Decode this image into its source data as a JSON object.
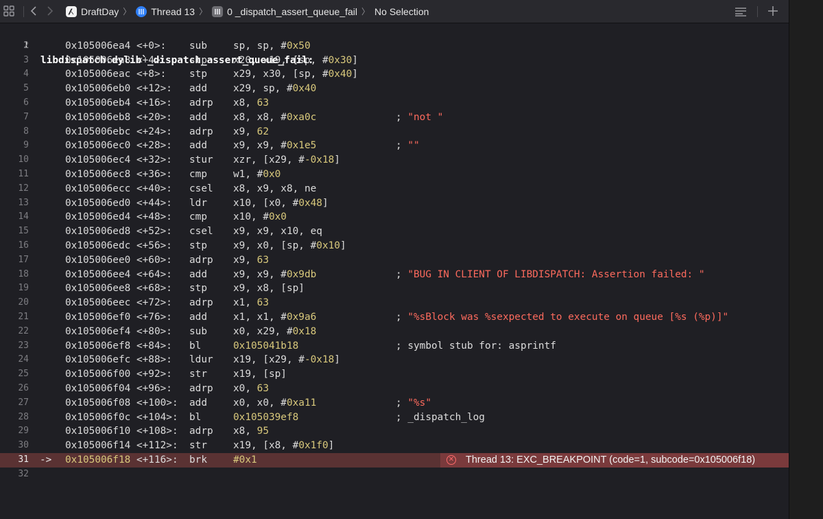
{
  "jumpbar": {
    "crumbs": [
      {
        "label": "DraftDay",
        "icon": "app-icon"
      },
      {
        "label": "Thread 13",
        "icon": "thread-icon"
      },
      {
        "label": "0 _dispatch_assert_queue_fail",
        "icon": "stack-frame-icon"
      },
      {
        "label": "No Selection",
        "icon": ""
      }
    ]
  },
  "disassembly": {
    "header": {
      "num": "1",
      "text": "libdispatch.dylib`_dispatch_assert_queue_fail:"
    },
    "lines": [
      {
        "num": "2",
        "addr": "0x105006ea4",
        "off": "<+0>:",
        "mn": "sub",
        "op": [
          [
            "sp, sp, #",
            ""
          ],
          [
            "0x50",
            "n"
          ]
        ]
      },
      {
        "num": "3",
        "addr": "0x105006ea8",
        "off": "<+4>:",
        "mn": "stp",
        "op": [
          [
            "x20, x19, [sp, #",
            ""
          ],
          [
            "0x30",
            "n"
          ],
          [
            "]",
            ""
          ]
        ]
      },
      {
        "num": "4",
        "addr": "0x105006eac",
        "off": "<+8>:",
        "mn": "stp",
        "op": [
          [
            "x29, x30, [sp, #",
            ""
          ],
          [
            "0x40",
            "n"
          ],
          [
            "]",
            ""
          ]
        ]
      },
      {
        "num": "5",
        "addr": "0x105006eb0",
        "off": "<+12>:",
        "mn": "add",
        "op": [
          [
            "x29, sp, #",
            ""
          ],
          [
            "0x40",
            "n"
          ]
        ]
      },
      {
        "num": "6",
        "addr": "0x105006eb4",
        "off": "<+16>:",
        "mn": "adrp",
        "op": [
          [
            "x8, ",
            ""
          ],
          [
            "63",
            "n"
          ]
        ]
      },
      {
        "num": "7",
        "addr": "0x105006eb8",
        "off": "<+20>:",
        "mn": "add",
        "op": [
          [
            "x8, x8, #",
            ""
          ],
          [
            "0xa0c",
            "n"
          ]
        ],
        "cmt": "; ",
        "str": "\"not \""
      },
      {
        "num": "8",
        "addr": "0x105006ebc",
        "off": "<+24>:",
        "mn": "adrp",
        "op": [
          [
            "x9, ",
            ""
          ],
          [
            "62",
            "n"
          ]
        ]
      },
      {
        "num": "9",
        "addr": "0x105006ec0",
        "off": "<+28>:",
        "mn": "add",
        "op": [
          [
            "x9, x9, #",
            ""
          ],
          [
            "0x1e5",
            "n"
          ]
        ],
        "cmt": "; ",
        "str": "\"\""
      },
      {
        "num": "10",
        "addr": "0x105006ec4",
        "off": "<+32>:",
        "mn": "stur",
        "op": [
          [
            "xzr, [x29, #",
            ""
          ],
          [
            "-0x18",
            "n"
          ],
          [
            "]",
            ""
          ]
        ]
      },
      {
        "num": "11",
        "addr": "0x105006ec8",
        "off": "<+36>:",
        "mn": "cmp",
        "op": [
          [
            "w1, #",
            ""
          ],
          [
            "0x0",
            "n"
          ]
        ]
      },
      {
        "num": "12",
        "addr": "0x105006ecc",
        "off": "<+40>:",
        "mn": "csel",
        "op": [
          [
            "x8, x9, x8, ne",
            ""
          ]
        ]
      },
      {
        "num": "13",
        "addr": "0x105006ed0",
        "off": "<+44>:",
        "mn": "ldr",
        "op": [
          [
            "x10, [x0, #",
            ""
          ],
          [
            "0x48",
            "n"
          ],
          [
            "]",
            ""
          ]
        ]
      },
      {
        "num": "14",
        "addr": "0x105006ed4",
        "off": "<+48>:",
        "mn": "cmp",
        "op": [
          [
            "x10, #",
            ""
          ],
          [
            "0x0",
            "n"
          ]
        ]
      },
      {
        "num": "15",
        "addr": "0x105006ed8",
        "off": "<+52>:",
        "mn": "csel",
        "op": [
          [
            "x9, x9, x10, eq",
            ""
          ]
        ]
      },
      {
        "num": "16",
        "addr": "0x105006edc",
        "off": "<+56>:",
        "mn": "stp",
        "op": [
          [
            "x9, x0, [sp, #",
            ""
          ],
          [
            "0x10",
            "n"
          ],
          [
            "]",
            ""
          ]
        ]
      },
      {
        "num": "17",
        "addr": "0x105006ee0",
        "off": "<+60>:",
        "mn": "adrp",
        "op": [
          [
            "x9, ",
            ""
          ],
          [
            "63",
            "n"
          ]
        ]
      },
      {
        "num": "18",
        "addr": "0x105006ee4",
        "off": "<+64>:",
        "mn": "add",
        "op": [
          [
            "x9, x9, #",
            ""
          ],
          [
            "0x9db",
            "n"
          ]
        ],
        "cmt": "; ",
        "str": "\"BUG IN CLIENT OF LIBDISPATCH: Assertion failed: \""
      },
      {
        "num": "19",
        "addr": "0x105006ee8",
        "off": "<+68>:",
        "mn": "stp",
        "op": [
          [
            "x9, x8, [sp]",
            ""
          ]
        ]
      },
      {
        "num": "20",
        "addr": "0x105006eec",
        "off": "<+72>:",
        "mn": "adrp",
        "op": [
          [
            "x1, ",
            ""
          ],
          [
            "63",
            "n"
          ]
        ]
      },
      {
        "num": "21",
        "addr": "0x105006ef0",
        "off": "<+76>:",
        "mn": "add",
        "op": [
          [
            "x1, x1, #",
            ""
          ],
          [
            "0x9a6",
            "n"
          ]
        ],
        "cmt": "; ",
        "str": "\"%sBlock was %sexpected to execute on queue [%s (%p)]\""
      },
      {
        "num": "22",
        "addr": "0x105006ef4",
        "off": "<+80>:",
        "mn": "sub",
        "op": [
          [
            "x0, x29, #",
            ""
          ],
          [
            "0x18",
            "n"
          ]
        ]
      },
      {
        "num": "23",
        "addr": "0x105006ef8",
        "off": "<+84>:",
        "mn": "bl",
        "op": [
          [
            "0x105041b18",
            "n"
          ]
        ],
        "cmt": "; symbol stub for: asprintf",
        "str": ""
      },
      {
        "num": "24",
        "addr": "0x105006efc",
        "off": "<+88>:",
        "mn": "ldur",
        "op": [
          [
            "x19, [x29, #",
            ""
          ],
          [
            "-0x18",
            "n"
          ],
          [
            "]",
            ""
          ]
        ]
      },
      {
        "num": "25",
        "addr": "0x105006f00",
        "off": "<+92>:",
        "mn": "str",
        "op": [
          [
            "x19, [sp]",
            ""
          ]
        ]
      },
      {
        "num": "26",
        "addr": "0x105006f04",
        "off": "<+96>:",
        "mn": "adrp",
        "op": [
          [
            "x0, ",
            ""
          ],
          [
            "63",
            "n"
          ]
        ]
      },
      {
        "num": "27",
        "addr": "0x105006f08",
        "off": "<+100>:",
        "mn": "add",
        "op": [
          [
            "x0, x0, #",
            ""
          ],
          [
            "0xa11",
            "n"
          ]
        ],
        "cmt": "; ",
        "str": "\"%s\""
      },
      {
        "num": "28",
        "addr": "0x105006f0c",
        "off": "<+104>:",
        "mn": "bl",
        "op": [
          [
            "0x105039ef8",
            "n"
          ]
        ],
        "cmt": "; _dispatch_log",
        "str": ""
      },
      {
        "num": "29",
        "addr": "0x105006f10",
        "off": "<+108>:",
        "mn": "adrp",
        "op": [
          [
            "x8, ",
            ""
          ],
          [
            "95",
            "n"
          ]
        ]
      },
      {
        "num": "30",
        "addr": "0x105006f14",
        "off": "<+112>:",
        "mn": "str",
        "op": [
          [
            "x19, [x8, #",
            ""
          ],
          [
            "0x1f0",
            "n"
          ],
          [
            "]",
            ""
          ]
        ]
      },
      {
        "num": "31",
        "addr": "0x105006f18",
        "off": "<+116>:",
        "mn": "brk",
        "op": [
          [
            "#0x1",
            ""
          ]
        ],
        "current": true,
        "arrow": "->"
      },
      {
        "num": "32",
        "addr": "",
        "off": "",
        "mn": "",
        "op": []
      }
    ],
    "breakpoint_banner": "Thread 13: EXC_BREAKPOINT (code=1, subcode=0x105006f18)"
  },
  "colors": {
    "number": "#d9c97c",
    "string": "#fc6a5d",
    "current_line": "#5a3233",
    "banner": "#7a3a3c"
  }
}
